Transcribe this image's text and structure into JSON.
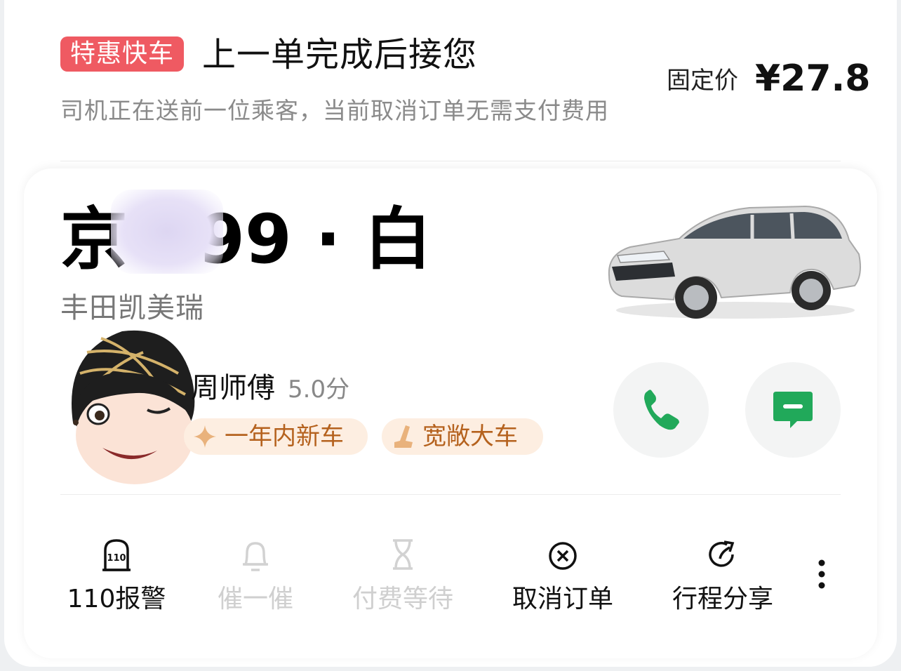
{
  "order": {
    "badge": "特惠快车",
    "title": "上一单完成后接您",
    "subtitle": "司机正在送前一位乘客，当前取消订单无需支付费用",
    "price_label": "固定价",
    "price_value": "¥27.8"
  },
  "vehicle": {
    "plate": "京        999 · 白",
    "model": "丰田凯美瑞"
  },
  "driver": {
    "name": "周师傅",
    "rating": "5.0分",
    "tags": [
      "一年内新车",
      "宽敞大车"
    ]
  },
  "actions": [
    {
      "label": "110报警",
      "icon": "police-110-icon",
      "enabled": true
    },
    {
      "label": "催一催",
      "icon": "bell-icon",
      "enabled": false
    },
    {
      "label": "付费等待",
      "icon": "hourglass-icon",
      "enabled": false
    },
    {
      "label": "取消订单",
      "icon": "cancel-circle-icon",
      "enabled": true
    },
    {
      "label": "行程分享",
      "icon": "share-arrow-icon",
      "enabled": true
    }
  ],
  "colors": {
    "badge_bg": "#ef5a62",
    "accent_green": "#21a95a",
    "tag_bg": "#fdeee1",
    "tag_text": "#b5621e"
  }
}
